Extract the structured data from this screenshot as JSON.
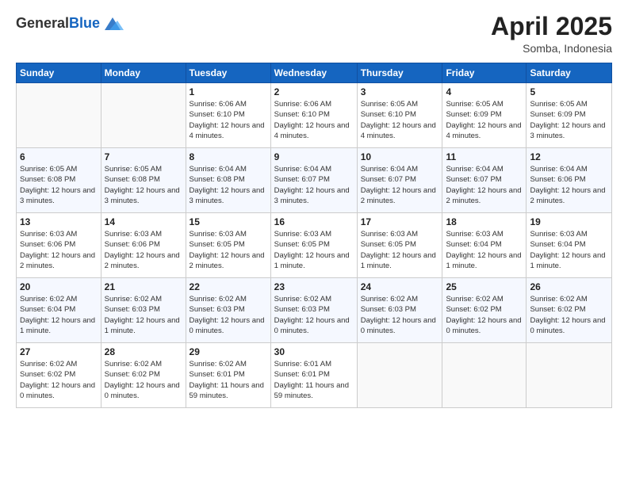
{
  "logo": {
    "general": "General",
    "blue": "Blue"
  },
  "header": {
    "month_year": "April 2025",
    "location": "Somba, Indonesia"
  },
  "weekdays": [
    "Sunday",
    "Monday",
    "Tuesday",
    "Wednesday",
    "Thursday",
    "Friday",
    "Saturday"
  ],
  "weeks": [
    [
      {
        "day": "",
        "detail": ""
      },
      {
        "day": "",
        "detail": ""
      },
      {
        "day": "1",
        "detail": "Sunrise: 6:06 AM\nSunset: 6:10 PM\nDaylight: 12 hours and 4 minutes."
      },
      {
        "day": "2",
        "detail": "Sunrise: 6:06 AM\nSunset: 6:10 PM\nDaylight: 12 hours and 4 minutes."
      },
      {
        "day": "3",
        "detail": "Sunrise: 6:05 AM\nSunset: 6:10 PM\nDaylight: 12 hours and 4 minutes."
      },
      {
        "day": "4",
        "detail": "Sunrise: 6:05 AM\nSunset: 6:09 PM\nDaylight: 12 hours and 4 minutes."
      },
      {
        "day": "5",
        "detail": "Sunrise: 6:05 AM\nSunset: 6:09 PM\nDaylight: 12 hours and 3 minutes."
      }
    ],
    [
      {
        "day": "6",
        "detail": "Sunrise: 6:05 AM\nSunset: 6:08 PM\nDaylight: 12 hours and 3 minutes."
      },
      {
        "day": "7",
        "detail": "Sunrise: 6:05 AM\nSunset: 6:08 PM\nDaylight: 12 hours and 3 minutes."
      },
      {
        "day": "8",
        "detail": "Sunrise: 6:04 AM\nSunset: 6:08 PM\nDaylight: 12 hours and 3 minutes."
      },
      {
        "day": "9",
        "detail": "Sunrise: 6:04 AM\nSunset: 6:07 PM\nDaylight: 12 hours and 3 minutes."
      },
      {
        "day": "10",
        "detail": "Sunrise: 6:04 AM\nSunset: 6:07 PM\nDaylight: 12 hours and 2 minutes."
      },
      {
        "day": "11",
        "detail": "Sunrise: 6:04 AM\nSunset: 6:07 PM\nDaylight: 12 hours and 2 minutes."
      },
      {
        "day": "12",
        "detail": "Sunrise: 6:04 AM\nSunset: 6:06 PM\nDaylight: 12 hours and 2 minutes."
      }
    ],
    [
      {
        "day": "13",
        "detail": "Sunrise: 6:03 AM\nSunset: 6:06 PM\nDaylight: 12 hours and 2 minutes."
      },
      {
        "day": "14",
        "detail": "Sunrise: 6:03 AM\nSunset: 6:06 PM\nDaylight: 12 hours and 2 minutes."
      },
      {
        "day": "15",
        "detail": "Sunrise: 6:03 AM\nSunset: 6:05 PM\nDaylight: 12 hours and 2 minutes."
      },
      {
        "day": "16",
        "detail": "Sunrise: 6:03 AM\nSunset: 6:05 PM\nDaylight: 12 hours and 1 minute."
      },
      {
        "day": "17",
        "detail": "Sunrise: 6:03 AM\nSunset: 6:05 PM\nDaylight: 12 hours and 1 minute."
      },
      {
        "day": "18",
        "detail": "Sunrise: 6:03 AM\nSunset: 6:04 PM\nDaylight: 12 hours and 1 minute."
      },
      {
        "day": "19",
        "detail": "Sunrise: 6:03 AM\nSunset: 6:04 PM\nDaylight: 12 hours and 1 minute."
      }
    ],
    [
      {
        "day": "20",
        "detail": "Sunrise: 6:02 AM\nSunset: 6:04 PM\nDaylight: 12 hours and 1 minute."
      },
      {
        "day": "21",
        "detail": "Sunrise: 6:02 AM\nSunset: 6:03 PM\nDaylight: 12 hours and 1 minute."
      },
      {
        "day": "22",
        "detail": "Sunrise: 6:02 AM\nSunset: 6:03 PM\nDaylight: 12 hours and 0 minutes."
      },
      {
        "day": "23",
        "detail": "Sunrise: 6:02 AM\nSunset: 6:03 PM\nDaylight: 12 hours and 0 minutes."
      },
      {
        "day": "24",
        "detail": "Sunrise: 6:02 AM\nSunset: 6:03 PM\nDaylight: 12 hours and 0 minutes."
      },
      {
        "day": "25",
        "detail": "Sunrise: 6:02 AM\nSunset: 6:02 PM\nDaylight: 12 hours and 0 minutes."
      },
      {
        "day": "26",
        "detail": "Sunrise: 6:02 AM\nSunset: 6:02 PM\nDaylight: 12 hours and 0 minutes."
      }
    ],
    [
      {
        "day": "27",
        "detail": "Sunrise: 6:02 AM\nSunset: 6:02 PM\nDaylight: 12 hours and 0 minutes."
      },
      {
        "day": "28",
        "detail": "Sunrise: 6:02 AM\nSunset: 6:02 PM\nDaylight: 12 hours and 0 minutes."
      },
      {
        "day": "29",
        "detail": "Sunrise: 6:02 AM\nSunset: 6:01 PM\nDaylight: 11 hours and 59 minutes."
      },
      {
        "day": "30",
        "detail": "Sunrise: 6:01 AM\nSunset: 6:01 PM\nDaylight: 11 hours and 59 minutes."
      },
      {
        "day": "",
        "detail": ""
      },
      {
        "day": "",
        "detail": ""
      },
      {
        "day": "",
        "detail": ""
      }
    ]
  ]
}
